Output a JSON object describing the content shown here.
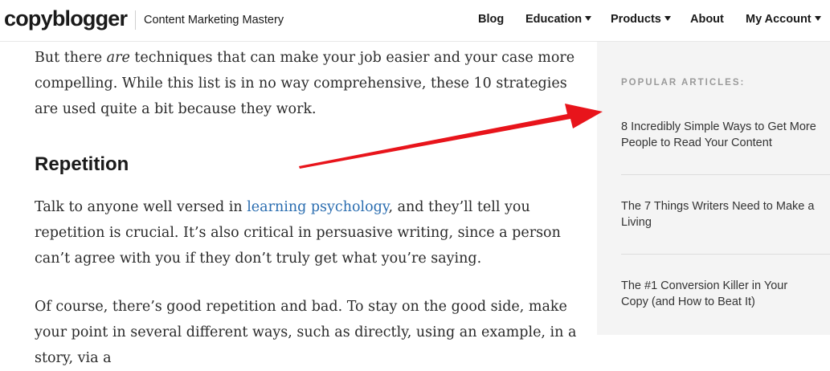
{
  "header": {
    "logo": "copyblogger",
    "tagline": "Content Marketing Mastery",
    "nav": [
      {
        "label": "Blog"
      },
      {
        "label": "Education"
      },
      {
        "label": "Products"
      },
      {
        "label": "About"
      },
      {
        "label": "My Account"
      }
    ]
  },
  "article": {
    "p1_before": "But there ",
    "p1_em": "are",
    "p1_after": " techniques that can make your job easier and your case more compelling. While this list is in no way comprehensive, these 10 strategies are used quite a bit because they work.",
    "heading": "Repetition",
    "p2_before": "Talk to anyone well versed in ",
    "p2_link": "learning psychology",
    "p2_after": ", and they’ll tell you repetition is crucial. It’s also critical in persuasive writing, since a person can’t agree with you if they don’t truly get what you’re saying.",
    "p3": "Of course, there’s good repetition and bad. To stay on the good side, make your point in several different ways, such as directly, using an example, in a story, via a"
  },
  "sidebar": {
    "title": "POPULAR ARTICLES:",
    "items": [
      {
        "label": "8 Incredibly Simple Ways to Get More People to Read Your Content"
      },
      {
        "label": "The 7 Things Writers Need to Make a Living"
      },
      {
        "label": "The #1 Conversion Killer in Your Copy (and How to Beat It)"
      }
    ]
  },
  "colors": {
    "arrow": "#e8141b",
    "link": "#2a6db0",
    "sidebar_bg": "#f4f4f4"
  }
}
